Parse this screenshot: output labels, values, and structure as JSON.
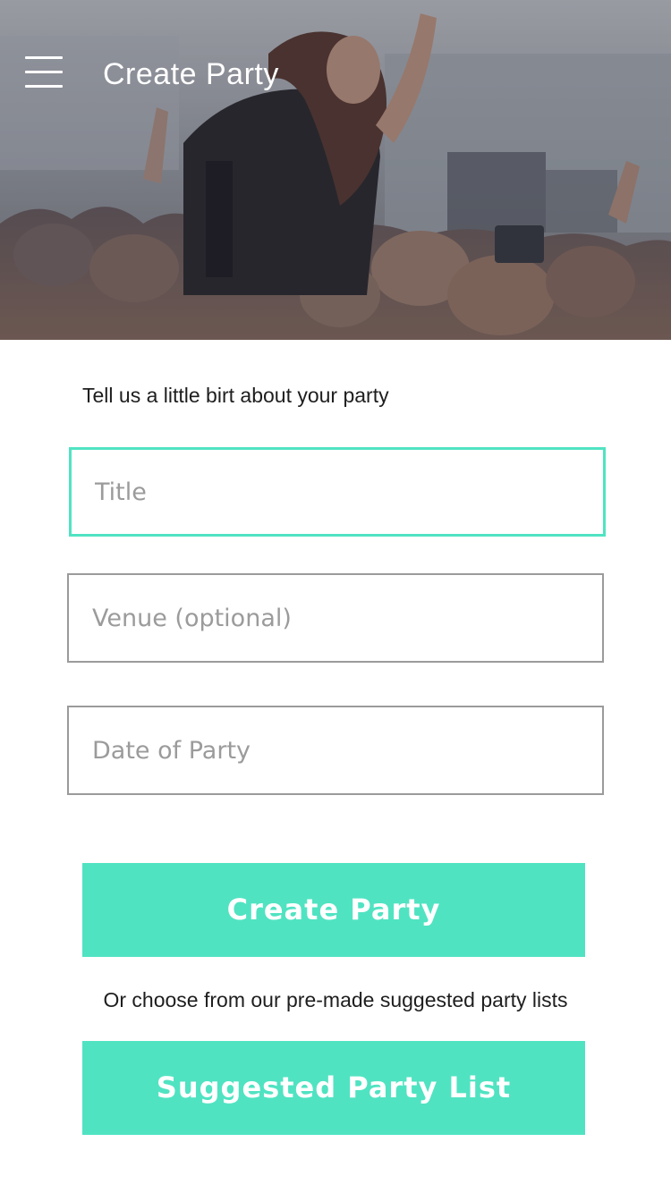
{
  "header": {
    "title": "Create Party",
    "menu_icon": "hamburger-menu-icon",
    "hero_image": "concert-crowd-photo"
  },
  "form": {
    "intro": "Tell us a little birt about your party",
    "fields": {
      "title": {
        "value": "",
        "placeholder": "Title",
        "state": "focused"
      },
      "venue": {
        "value": "",
        "placeholder": "Venue (optional)"
      },
      "date": {
        "value": "",
        "placeholder": "Date of Party"
      }
    },
    "create_button_label": "Create Party",
    "or_text": "Or choose from our pre-made suggested party lists",
    "suggested_button_label": "Suggested Party List"
  },
  "colors": {
    "accent": "#50e3c2",
    "field_border": "#9b9b9b",
    "placeholder": "#9b9b9b",
    "text": "#1e1e1e"
  }
}
